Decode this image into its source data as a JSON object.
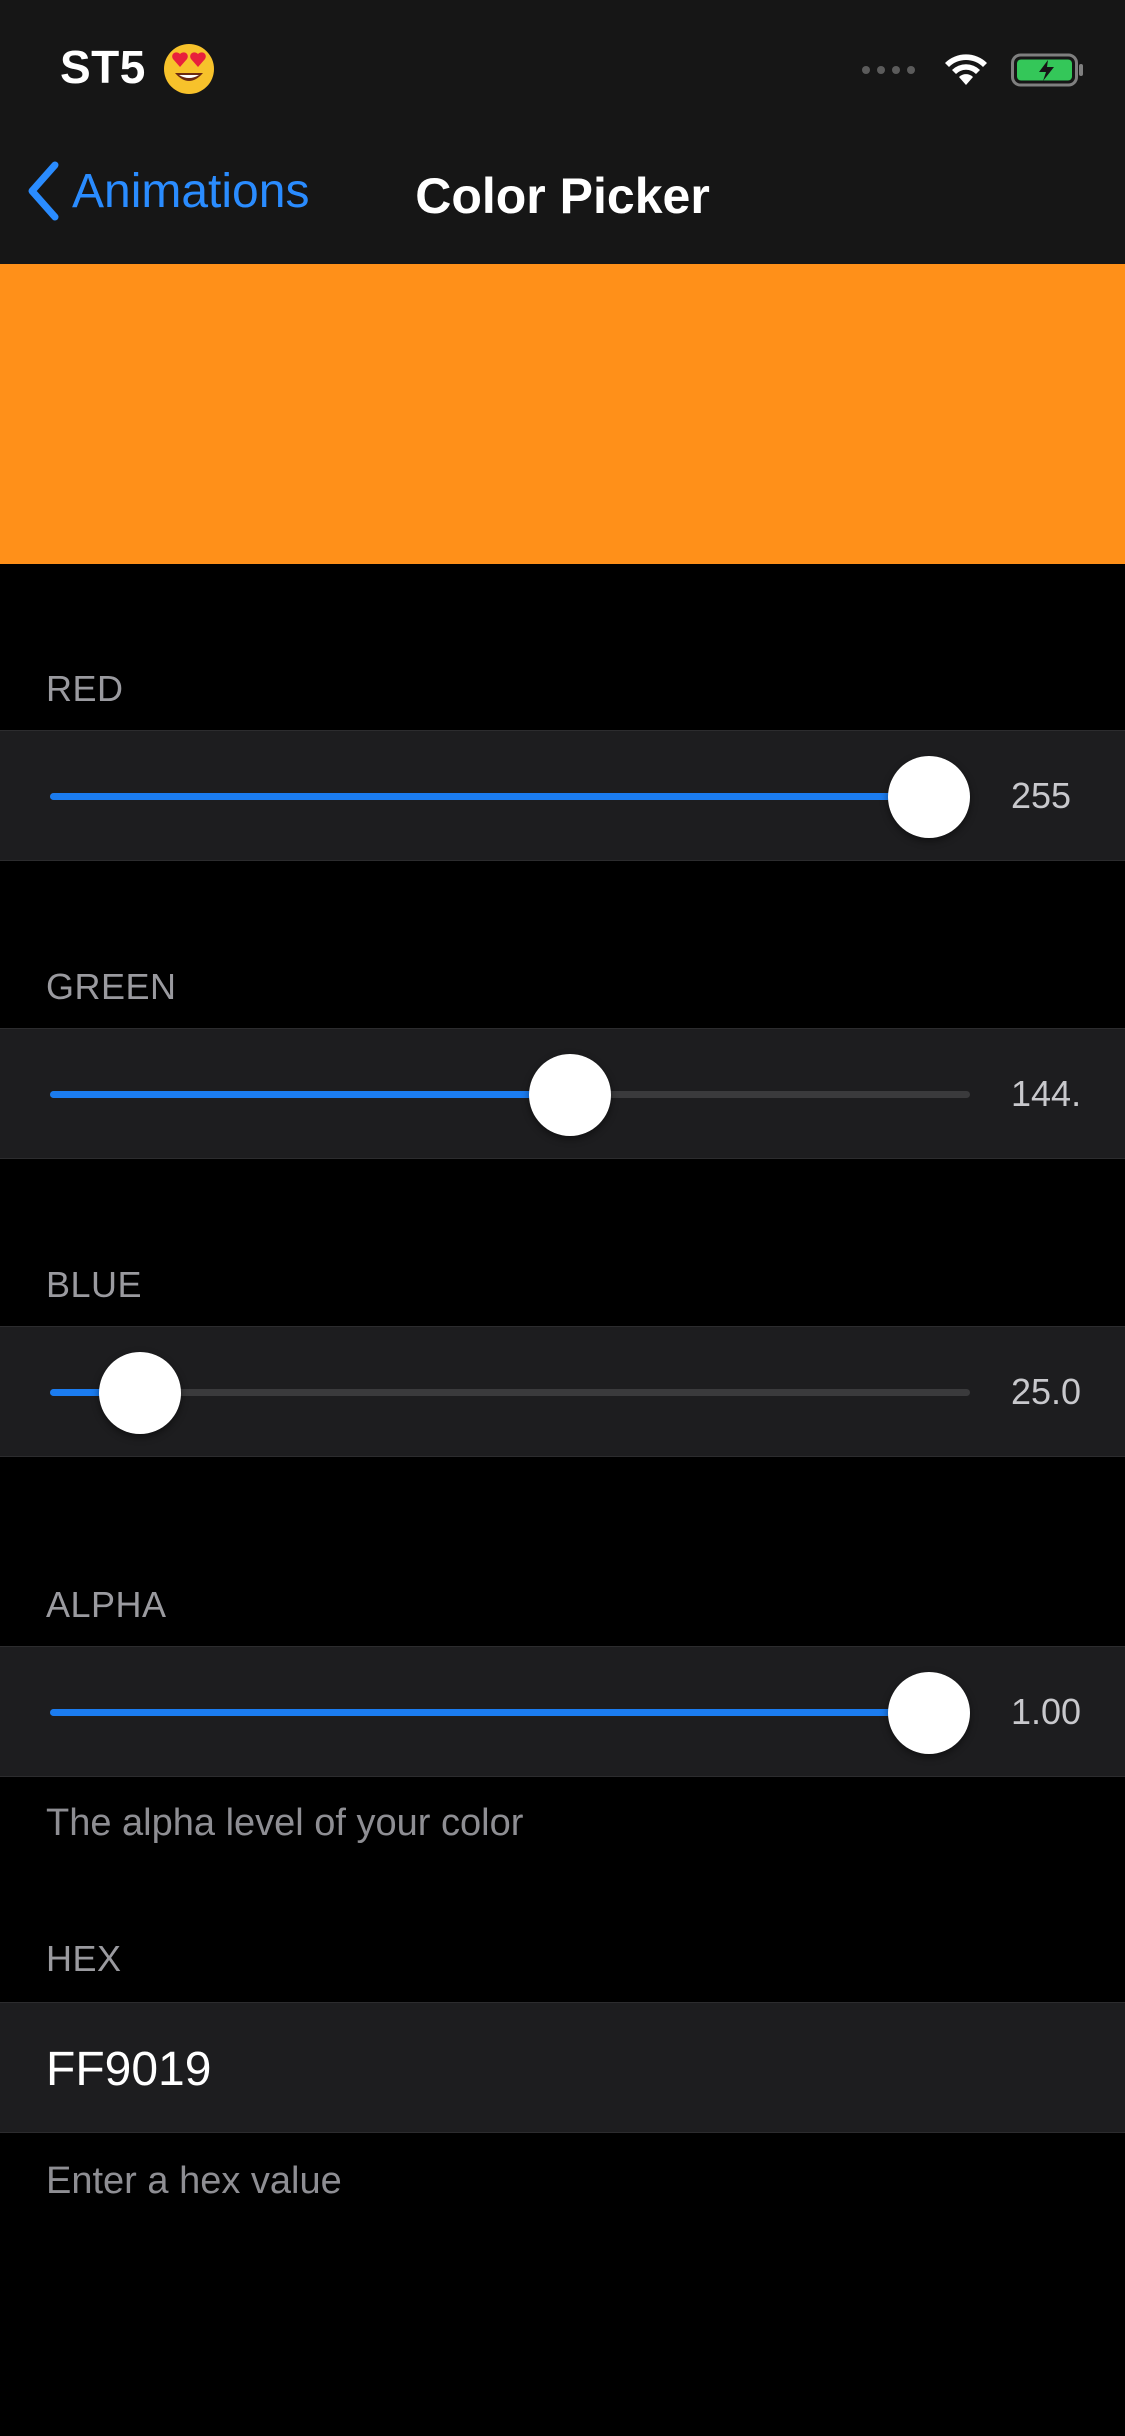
{
  "status_bar": {
    "time": "ST5",
    "emoji_icon": "heart-eyes-emoji",
    "battery_color": "#34c759"
  },
  "nav": {
    "back_label": "Animations",
    "title": "Color Picker"
  },
  "swatch": {
    "color": "#FF9019"
  },
  "sliders": [
    {
      "key": "red",
      "label": "RED",
      "value_text": "255",
      "fraction": 1.0
    },
    {
      "key": "green",
      "label": "GREEN",
      "value_text": "144.",
      "fraction": 0.565
    },
    {
      "key": "blue",
      "label": "BLUE",
      "value_text": "25.0",
      "fraction": 0.098
    },
    {
      "key": "alpha",
      "label": "ALPHA",
      "value_text": "1.00",
      "fraction": 1.0
    }
  ],
  "alpha_note": "The alpha level of your color",
  "hex": {
    "label": "HEX",
    "value": "FF9019",
    "note": "Enter a hex value"
  },
  "colors": {
    "accent": "#1b7cf0",
    "background": "#000000",
    "cell": "#1d1d1f"
  }
}
